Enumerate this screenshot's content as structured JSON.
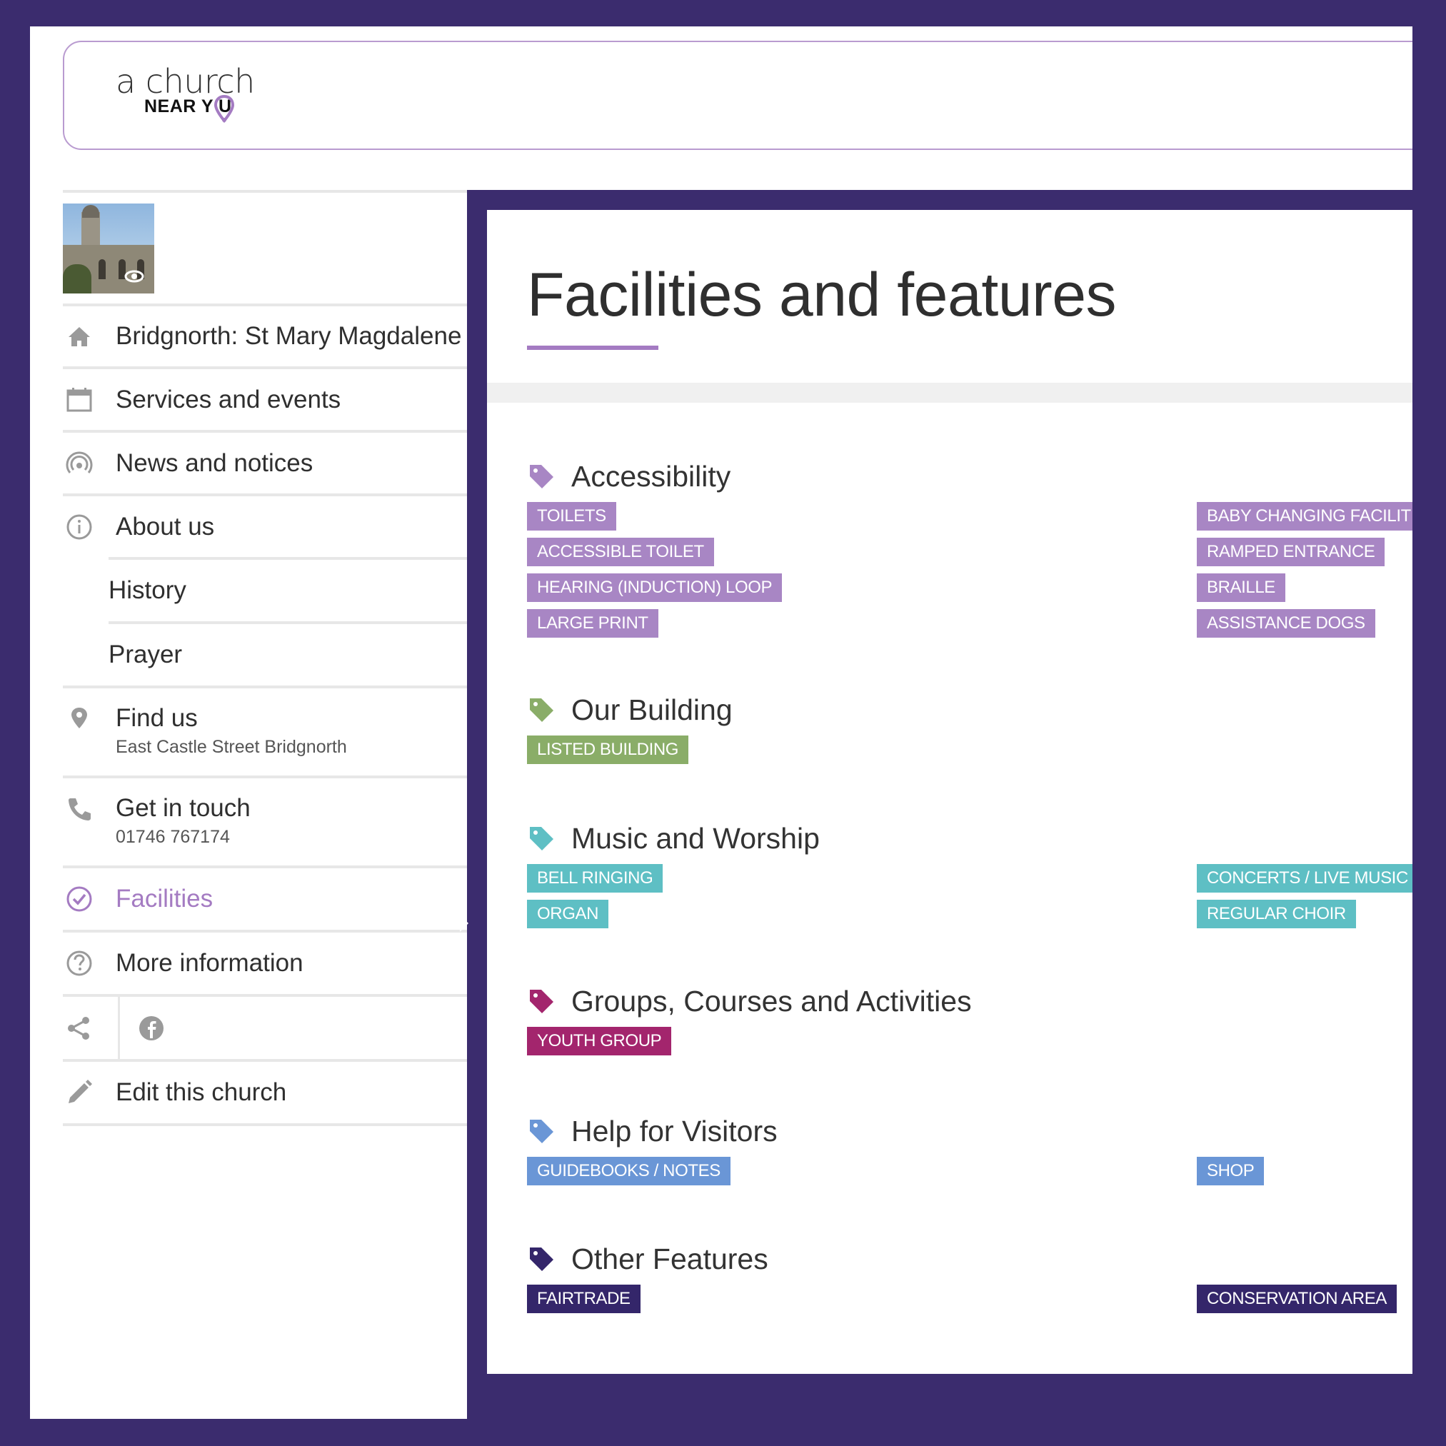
{
  "header": {
    "logo_line1": "a church",
    "logo_line2": "NEAR Y  U"
  },
  "sidebar": {
    "church_name": "Bridgnorth: St Mary Magdalene",
    "services": "Services and events",
    "news": "News and notices",
    "about": "About us",
    "history": "History",
    "prayer": "Prayer",
    "find_us": "Find us",
    "find_us_sub": "East Castle Street Bridgnorth",
    "get_in_touch": "Get in touch",
    "phone": "01746 767174",
    "facilities": "Facilities",
    "more_info": "More information",
    "edit": "Edit this church"
  },
  "main": {
    "title": "Facilities and features",
    "sections": [
      {
        "heading": "Accessibility",
        "color": "#a886c4",
        "left_tags": [
          "TOILETS",
          "ACCESSIBLE TOILET",
          "HEARING (INDUCTION) LOOP",
          "LARGE PRINT"
        ],
        "right_tags": [
          "BABY CHANGING FACILITIES",
          "RAMPED ENTRANCE",
          "BRAILLE",
          "ASSISTANCE DOGS"
        ]
      },
      {
        "heading": "Our Building",
        "color": "#8aad68",
        "left_tags": [
          "LISTED BUILDING"
        ],
        "right_tags": []
      },
      {
        "heading": "Music and Worship",
        "color": "#5ebfc4",
        "left_tags": [
          "BELL RINGING",
          "ORGAN"
        ],
        "right_tags": [
          "CONCERTS / LIVE MUSIC",
          "REGULAR CHOIR"
        ]
      },
      {
        "heading": "Groups, Courses and Activities",
        "color": "#a3256d",
        "left_tags": [
          "YOUTH GROUP"
        ],
        "right_tags": []
      },
      {
        "heading": "Help for Visitors",
        "color": "#6a96d6",
        "left_tags": [
          "GUIDEBOOKS / NOTES"
        ],
        "right_tags": [
          "SHOP"
        ]
      },
      {
        "heading": "Other Features",
        "color": "#34266a",
        "left_tags": [
          "FAIRTRADE"
        ],
        "right_tags": [
          "CONSERVATION AREA"
        ]
      }
    ]
  },
  "colors": {
    "brand_purple": "#3b2c6e",
    "accent_lilac": "#a47bc2"
  }
}
